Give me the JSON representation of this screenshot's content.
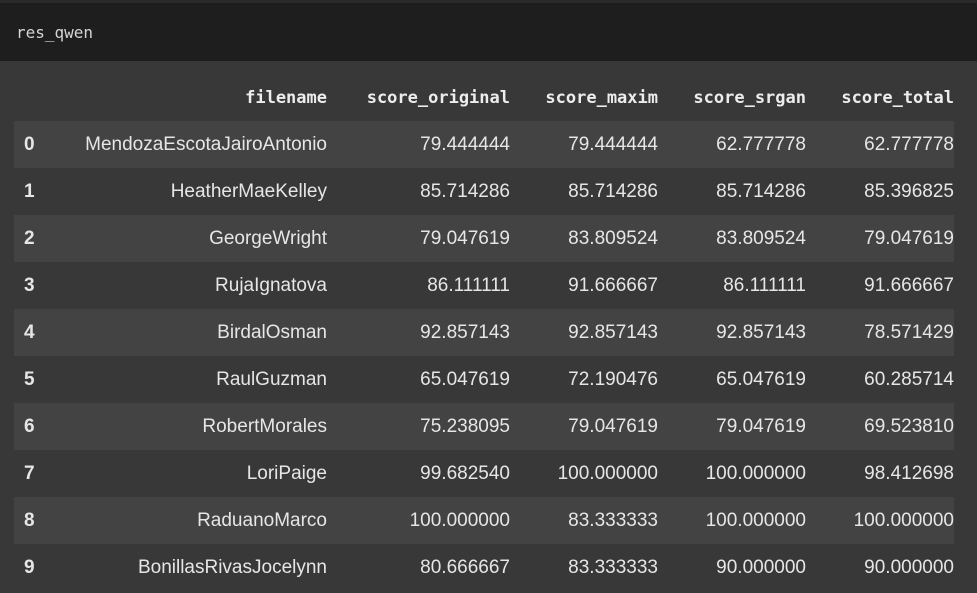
{
  "cell": {
    "code": "res_qwen"
  },
  "table": {
    "columns": [
      "filename",
      "score_original",
      "score_maxim",
      "score_srgan",
      "score_total"
    ],
    "rows": [
      {
        "index": "0",
        "filename": "MendozaEscotaJairoAntonio",
        "score_original": "79.444444",
        "score_maxim": "79.444444",
        "score_srgan": "62.777778",
        "score_total": "62.777778"
      },
      {
        "index": "1",
        "filename": "HeatherMaeKelley",
        "score_original": "85.714286",
        "score_maxim": "85.714286",
        "score_srgan": "85.714286",
        "score_total": "85.396825"
      },
      {
        "index": "2",
        "filename": "GeorgeWright",
        "score_original": "79.047619",
        "score_maxim": "83.809524",
        "score_srgan": "83.809524",
        "score_total": "79.047619"
      },
      {
        "index": "3",
        "filename": "RujaIgnatova",
        "score_original": "86.111111",
        "score_maxim": "91.666667",
        "score_srgan": "86.111111",
        "score_total": "91.666667"
      },
      {
        "index": "4",
        "filename": "BirdalOsman",
        "score_original": "92.857143",
        "score_maxim": "92.857143",
        "score_srgan": "92.857143",
        "score_total": "78.571429"
      },
      {
        "index": "5",
        "filename": "RaulGuzman",
        "score_original": "65.047619",
        "score_maxim": "72.190476",
        "score_srgan": "65.047619",
        "score_total": "60.285714"
      },
      {
        "index": "6",
        "filename": "RobertMorales",
        "score_original": "75.238095",
        "score_maxim": "79.047619",
        "score_srgan": "79.047619",
        "score_total": "69.523810"
      },
      {
        "index": "7",
        "filename": "LoriPaige",
        "score_original": "99.682540",
        "score_maxim": "100.000000",
        "score_srgan": "100.000000",
        "score_total": "98.412698"
      },
      {
        "index": "8",
        "filename": "RaduanoMarco",
        "score_original": "100.000000",
        "score_maxim": "83.333333",
        "score_srgan": "100.000000",
        "score_total": "100.000000"
      },
      {
        "index": "9",
        "filename": "BonillasRivasJocelynn",
        "score_original": "80.666667",
        "score_maxim": "83.333333",
        "score_srgan": "90.000000",
        "score_total": "90.000000"
      }
    ]
  }
}
